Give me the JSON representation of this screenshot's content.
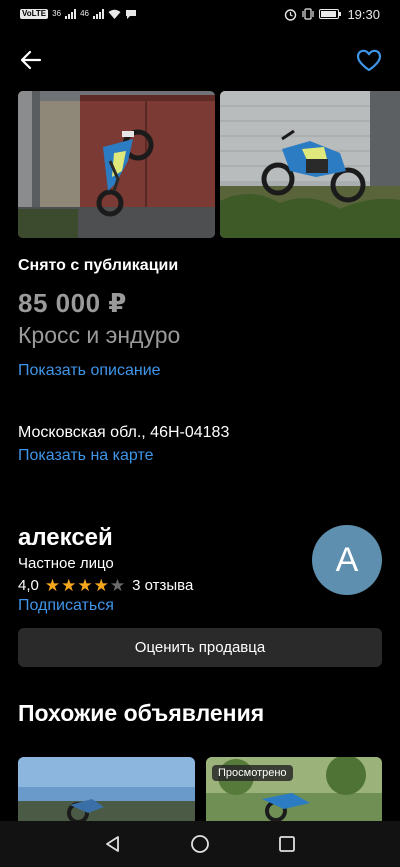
{
  "status_bar": {
    "left_badges": [
      "VoLTE",
      "36",
      "46"
    ],
    "time": "19:30",
    "icons": [
      "sim-badge-icon",
      "signal-icon",
      "wifi-icon",
      "chat-bubble-icon",
      "alarm-icon",
      "vibrate-icon",
      "battery-icon"
    ],
    "battery_level": 0.9
  },
  "topbar": {
    "back_icon": "arrow-left-icon",
    "favorite_icon": "heart-outline-icon",
    "accent_color": "#3f95e8"
  },
  "gallery": {
    "photos": [
      "motorcycle-photo-1",
      "motorcycle-photo-2"
    ]
  },
  "listing": {
    "status": "Снято с публикации",
    "price": "85 000 ₽",
    "category": "Кросс и эндуро",
    "show_description": "Показать описание",
    "address": "Московская обл., 46Н-04183",
    "show_on_map": "Показать на карте"
  },
  "seller": {
    "name": "алексей",
    "type": "Частное лицо",
    "rating": "4,0",
    "rating_numeric": 4,
    "rating_max": 5,
    "reviews": "3 отзыва",
    "subscribe": "Подписаться",
    "avatar_letter": "А",
    "avatar_color": "#5e8fae",
    "rate_button": "Оценить продавца"
  },
  "similar": {
    "title": "Похожие объявления",
    "items": [
      {
        "badge": ""
      },
      {
        "badge": "Просмотрено"
      }
    ]
  },
  "navbar": {
    "icons": [
      "back-triangle-icon",
      "home-circle-icon",
      "recents-square-icon"
    ]
  }
}
